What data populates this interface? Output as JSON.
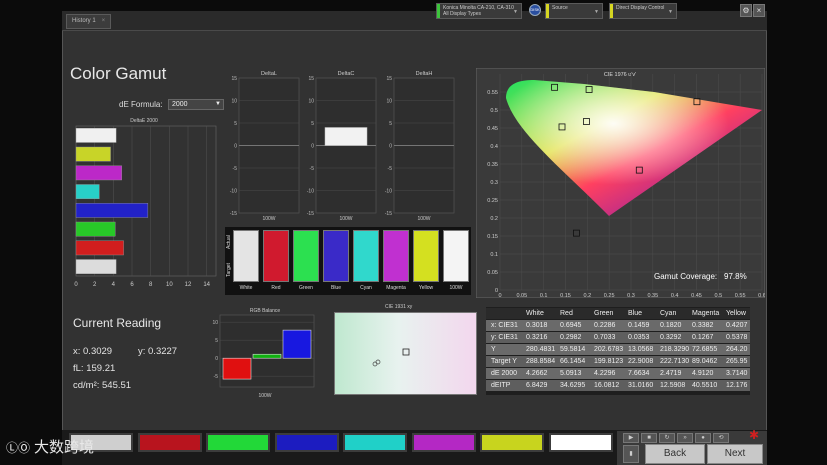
{
  "topbar": {
    "tab_label": "History 1",
    "tab_close": "×",
    "device_line1": "Konica Minolta CA-210, CA-310",
    "device_line2": "All Display Types",
    "device_color": "#3cc43c",
    "source_label": "Source",
    "source_color": "#d6d622",
    "control_label": "Direct Display Control",
    "control_color": "#d6d622",
    "disk_text": "DISK",
    "gear_icon": "⚙",
    "close_icon": "×"
  },
  "page_title": "Color Gamut",
  "de_formula": {
    "label": "dE Formula:",
    "value": "2000"
  },
  "deltaE_chart": {
    "title": "DeltaE 2000",
    "ticks": [
      "0",
      "2",
      "4",
      "6",
      "8",
      "10",
      "12",
      "14"
    ],
    "xlim": [
      0,
      15
    ],
    "bars": [
      {
        "name": "White",
        "value": 4.3,
        "color": "#f0f0f0"
      },
      {
        "name": "Yellow",
        "value": 3.7,
        "color": "#c8d428"
      },
      {
        "name": "Magenta",
        "value": 4.9,
        "color": "#bc28c8"
      },
      {
        "name": "Cyan",
        "value": 2.5,
        "color": "#28d0c8"
      },
      {
        "name": "Blue",
        "value": 7.7,
        "color": "#2222c8"
      },
      {
        "name": "Green",
        "value": 4.2,
        "color": "#28c828"
      },
      {
        "name": "Red",
        "value": 5.1,
        "color": "#d21e1e"
      },
      {
        "name": "Gray",
        "value": 4.3,
        "color": "#dcdcdc"
      }
    ]
  },
  "delta_charts": [
    {
      "title": "DeltaL",
      "label": "100W",
      "value": 0
    },
    {
      "title": "DeltaC",
      "label": "100W",
      "value": 4.0
    },
    {
      "title": "DeltaH",
      "label": "100W",
      "value": 0
    }
  ],
  "delta_ticks": [
    "15",
    "10",
    "5",
    "0",
    "-5",
    "-10",
    "-15"
  ],
  "color_tiles": {
    "actual_label": "Actual",
    "target_label": "Target",
    "tiles": [
      {
        "label": "White",
        "color": "#e4e4e4"
      },
      {
        "label": "Red",
        "color": "#d01a2e"
      },
      {
        "label": "Green",
        "color": "#2ce050"
      },
      {
        "label": "Blue",
        "color": "#3a2ac8"
      },
      {
        "label": "Cyan",
        "color": "#30d8cc"
      },
      {
        "label": "Magenta",
        "color": "#c030d0"
      },
      {
        "label": "Yellow",
        "color": "#d4e020"
      },
      {
        "label": "100W",
        "color": "#f4f4f4"
      }
    ]
  },
  "cie1976": {
    "title": "CIE 1976 u'v'",
    "coverage_label": "Gamut Coverage:",
    "coverage_value": "97.8%",
    "x_ticks": [
      "0",
      "0.05",
      "0.1",
      "0.15",
      "0.2",
      "0.25",
      "0.3",
      "0.35",
      "0.4",
      "0.45",
      "0.5",
      "0.55",
      "0.6"
    ],
    "y_ticks": [
      "0.55",
      "0.5",
      "0.45",
      "0.4",
      "0.35",
      "0.3",
      "0.25",
      "0.2",
      "0.15",
      "0.1",
      "0.05",
      "0"
    ],
    "xlim": [
      0,
      0.6
    ],
    "ylim": [
      0,
      0.6
    ],
    "targets": [
      {
        "name": "green",
        "u": 0.125,
        "v": 0.563
      },
      {
        "name": "yellow",
        "u": 0.204,
        "v": 0.557
      },
      {
        "name": "red",
        "u": 0.451,
        "v": 0.523
      },
      {
        "name": "white",
        "u": 0.198,
        "v": 0.468
      },
      {
        "name": "cyan",
        "u": 0.142,
        "v": 0.453
      },
      {
        "name": "magenta",
        "u": 0.319,
        "v": 0.333
      },
      {
        "name": "blue",
        "u": 0.175,
        "v": 0.158
      }
    ]
  },
  "current_reading": {
    "title": "Current Reading",
    "x": "x: 0.3029",
    "y": "y: 0.3227",
    "fl": "fL: 159.21",
    "cd": "cd/m²: 545.51"
  },
  "rgb_balance": {
    "title": "RGB Balance",
    "label": "100W",
    "ticks": [
      "10",
      "5",
      "0",
      "-5"
    ],
    "ylim": [
      -8,
      12
    ],
    "bars": [
      {
        "name": "R",
        "value": -5.8,
        "color": "#e01010"
      },
      {
        "name": "G",
        "value": 1.1,
        "color": "#10b010"
      },
      {
        "name": "B",
        "value": 7.8,
        "color": "#1818e0"
      }
    ]
  },
  "cie1931": {
    "title": "CIE 1931 xy"
  },
  "table": {
    "headers": [
      "",
      "White",
      "Red",
      "Green",
      "Blue",
      "Cyan",
      "Magenta",
      "Yellow"
    ],
    "rows": [
      [
        "x: CIE31",
        "0.3018",
        "0.6945",
        "0.2286",
        "0.1459",
        "0.1820",
        "0.3382",
        "0.4207"
      ],
      [
        "y: CIE31",
        "0.3216",
        "0.2982",
        "0.7033",
        "0.0353",
        "0.3292",
        "0.1267",
        "0.5378"
      ],
      [
        "Y",
        "280.4831",
        "59.5814",
        "202.6783",
        "13.0568",
        "218.3290",
        "72.6855",
        "264.20"
      ],
      [
        "Target Y",
        "288.8584",
        "66.1454",
        "199.8123",
        "22.9008",
        "222.7130",
        "89.0462",
        "265.95"
      ],
      [
        "dE 2000",
        "4.2662",
        "5.0913",
        "4.2296",
        "7.6634",
        "2.4719",
        "4.9120",
        "3.7140"
      ],
      [
        "dEITP",
        "6.8429",
        "34.6295",
        "16.0812",
        "31.0160",
        "12.5908",
        "40.5510",
        "12.176"
      ]
    ]
  },
  "bottom_swatches": [
    "#cfcfcf",
    "#b8141e",
    "#22d838",
    "#1c1cc0",
    "#20d0c8",
    "#b428c4",
    "#c8d41e",
    "#ffffff"
  ],
  "controls": {
    "back": "Back",
    "next": "Next",
    "stop_icon": "✱"
  },
  "watermark": {
    "logo": "ⓁⓄ",
    "text": "大数跨境"
  }
}
